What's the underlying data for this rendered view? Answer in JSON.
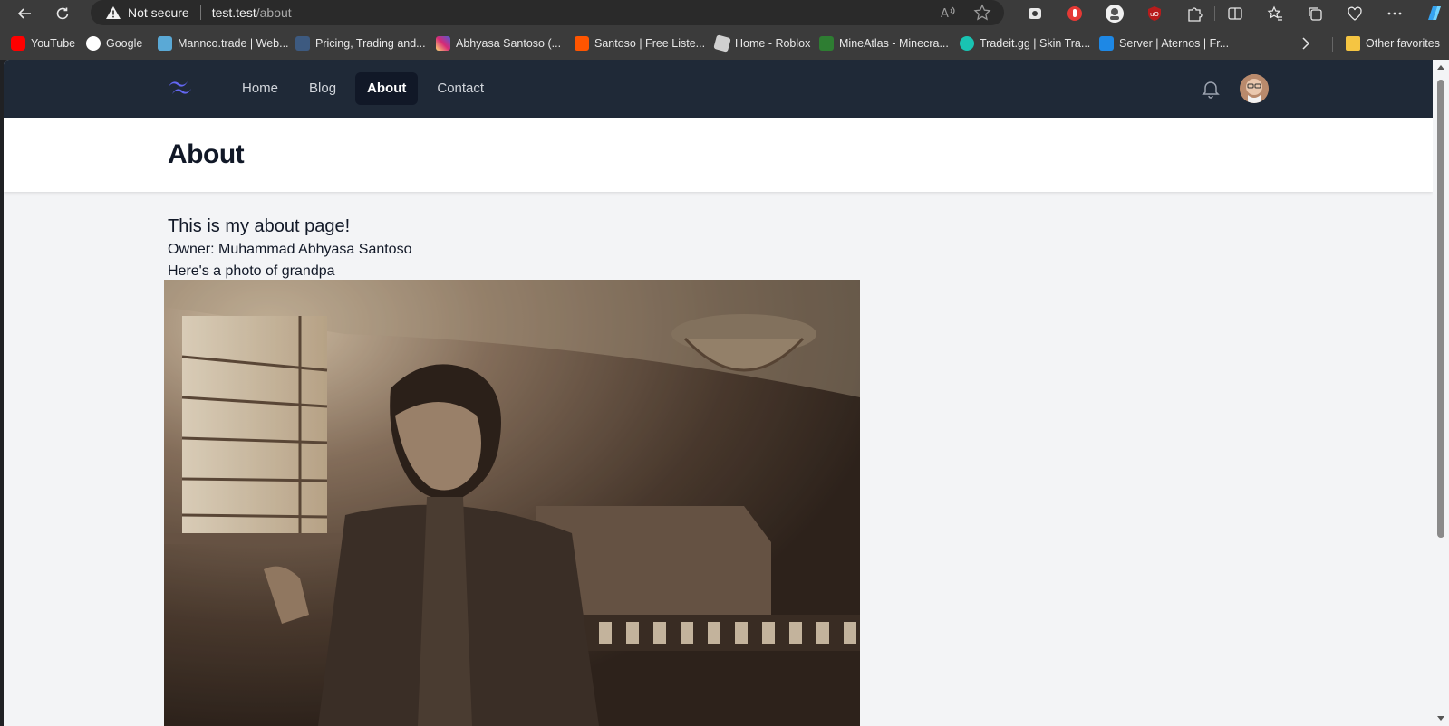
{
  "browser": {
    "security_label": "Not secure",
    "url_host": "test.test",
    "url_path": "/about"
  },
  "bookmarks": [
    {
      "label": "YouTube",
      "color": "#ff0000"
    },
    {
      "label": "Google",
      "color": "#4285f4"
    },
    {
      "label": "Mannco.trade | Web...",
      "color": "#5aa9d6"
    },
    {
      "label": "Pricing, Trading and...",
      "color": "#3d5a80"
    },
    {
      "label": "Abhyasa Santoso (...",
      "color": "#d62976"
    },
    {
      "label": "Santoso | Free Liste...",
      "color": "#ff5500"
    },
    {
      "label": "Home - Roblox",
      "color": "#d0d0d0"
    },
    {
      "label": "MineAtlas - Minecra...",
      "color": "#2e7d32"
    },
    {
      "label": "Tradeit.gg | Skin Tra...",
      "color": "#19c3b2"
    },
    {
      "label": "Server | Aternos | Fr...",
      "color": "#1e88e5"
    }
  ],
  "other_favorites": "Other favorites",
  "nav": {
    "links": [
      "Home",
      "Blog",
      "About",
      "Contact"
    ],
    "active": "About"
  },
  "page": {
    "title": "About",
    "intro": "This is my about page!",
    "owner": "Owner: Muhammad Abhyasa Santoso",
    "photo_caption": "Here's a photo of grandpa"
  },
  "colors": {
    "navbar_bg": "#1f2937",
    "active_link_bg": "#111827",
    "logo_accent": "#6366f1",
    "page_bg": "#f3f4f6"
  }
}
